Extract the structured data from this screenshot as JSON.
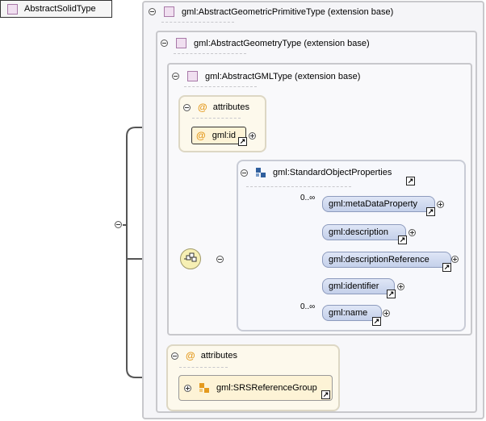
{
  "root": {
    "label": "AbstractSolidType"
  },
  "containers": {
    "primitive": {
      "label": "gml:AbstractGeometricPrimitiveType (extension base)"
    },
    "geometry": {
      "label": "gml:AbstractGeometryType (extension base)"
    },
    "gmltype": {
      "label": "gml:AbstractGMLType (extension base)"
    }
  },
  "attributes_top": {
    "title": "attributes",
    "at_symbol": "@",
    "item": {
      "label": "gml:id"
    }
  },
  "group": {
    "label": "gml:StandardObjectProperties",
    "elements": [
      {
        "label": "gml:metaDataProperty",
        "cardinality": "0..∞"
      },
      {
        "label": "gml:description",
        "cardinality": ""
      },
      {
        "label": "gml:descriptionReference",
        "cardinality": ""
      },
      {
        "label": "gml:identifier",
        "cardinality": ""
      },
      {
        "label": "gml:name",
        "cardinality": "0..∞"
      }
    ]
  },
  "attributes_bottom": {
    "title": "attributes",
    "at_symbol": "@",
    "item": {
      "label": "gml:SRSReferenceGroup"
    }
  },
  "icons": {
    "link": "↗",
    "type_icon_color": "#f0dff0",
    "element_color": "#c4d0ea",
    "sequence_color": "#f6efb4"
  }
}
